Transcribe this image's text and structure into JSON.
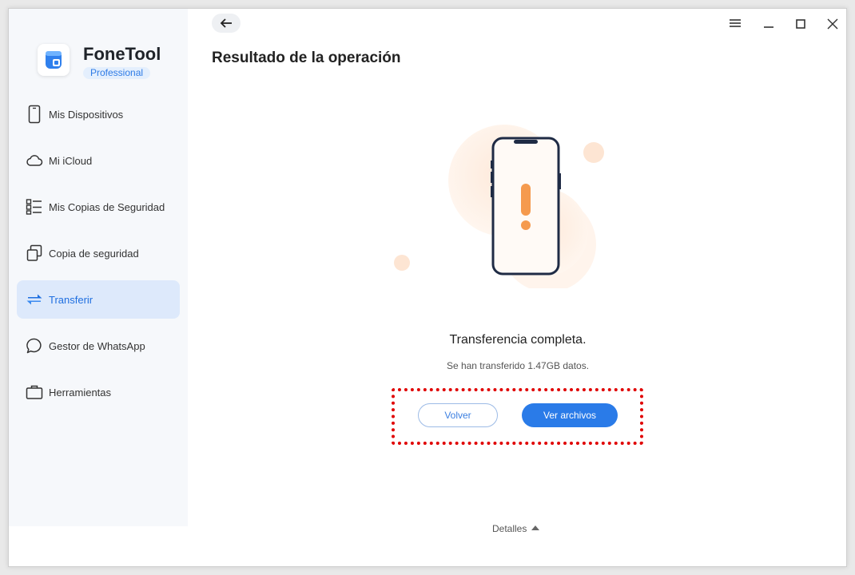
{
  "app": {
    "name": "FoneTool",
    "edition": "Professional"
  },
  "sidebar": {
    "items": [
      {
        "label": "Mis Dispositivos",
        "icon": "phone-icon",
        "active": false
      },
      {
        "label": "Mi iCloud",
        "icon": "cloud-icon",
        "active": false
      },
      {
        "label": "Mis Copias de Seguridad",
        "icon": "list-icon",
        "active": false
      },
      {
        "label": "Copia de seguridad",
        "icon": "copy-icon",
        "active": false
      },
      {
        "label": "Transferir",
        "icon": "transfer-icon",
        "active": true
      },
      {
        "label": "Gestor de WhatsApp",
        "icon": "chat-bubble-icon",
        "active": false
      },
      {
        "label": "Herramientas",
        "icon": "briefcase-icon",
        "active": false
      }
    ]
  },
  "titlebar": {
    "back_icon": "arrow-left-icon",
    "menu_icon": "menu-icon",
    "minimize_icon": "minimize-icon",
    "maximize_icon": "maximize-icon",
    "close_icon": "close-icon"
  },
  "main": {
    "title": "Resultado de la operación",
    "result_title": "Transferencia completa.",
    "result_subtitle": "Se han transferido 1.47GB datos.",
    "buttons": {
      "back_label": "Volver",
      "view_files_label": "Ver archivos"
    },
    "details_label": "Detalles"
  },
  "colors": {
    "accent": "#2a7be8",
    "sidebar_bg": "#f6f8fb",
    "active_item_bg": "#dde9fb",
    "warning": "#f59a4e",
    "highlight": "#e00000"
  }
}
